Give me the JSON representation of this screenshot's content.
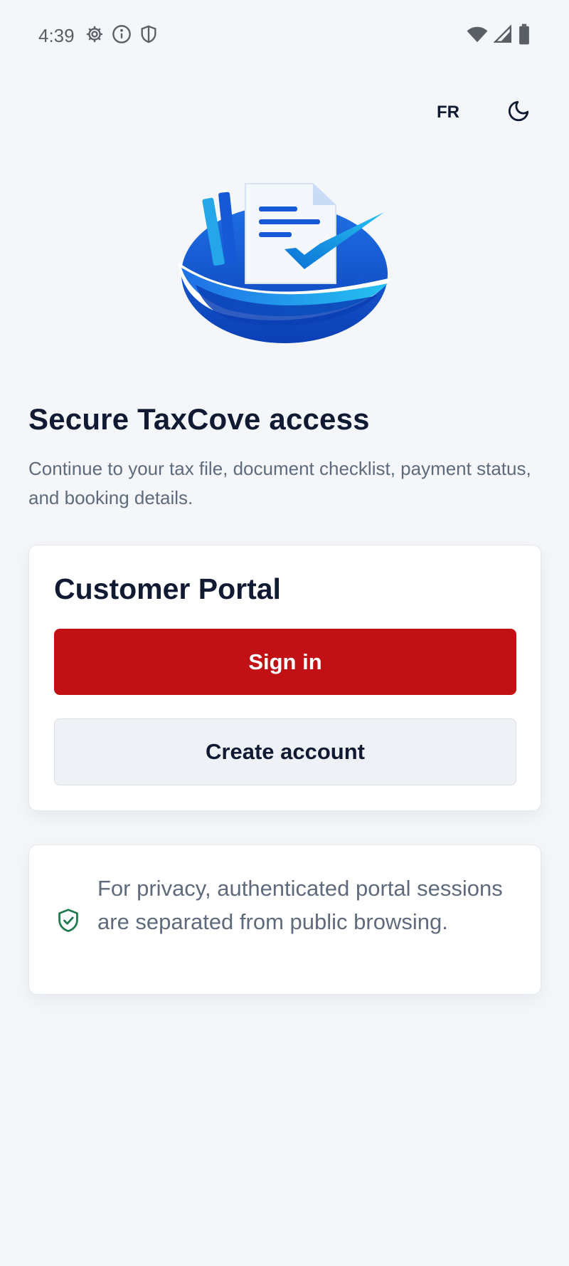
{
  "status_bar": {
    "time": "4:39",
    "left_icons": [
      "gear-icon",
      "info-icon",
      "shield-icon"
    ],
    "right_icons": [
      "wifi-icon",
      "signal-icon",
      "battery-icon"
    ]
  },
  "top_bar": {
    "language_label": "FR",
    "theme_icon": "moon-icon"
  },
  "logo": {
    "icon": "document-check-logo",
    "colors": {
      "blue_dark": "#0b3fb5",
      "blue_mid": "#1f6fe6",
      "cyan": "#25c1f0"
    }
  },
  "hero": {
    "title": "Secure TaxCove access",
    "subtitle": "Continue to your tax file, document checklist, payment status, and booking details."
  },
  "portal_card": {
    "title": "Customer Portal",
    "sign_in_label": "Sign in",
    "create_account_label": "Create account"
  },
  "privacy_note": {
    "icon": "shield-check-icon",
    "text": "For privacy, authenticated portal sessions are separated from public browsing."
  },
  "colors": {
    "background": "#f4f6f9",
    "primary": "#c21114",
    "text_dark": "#101a33",
    "text_muted": "#5f6b7c",
    "secondary_button": "#eef1f5",
    "shield_green": "#1e7a4c"
  }
}
